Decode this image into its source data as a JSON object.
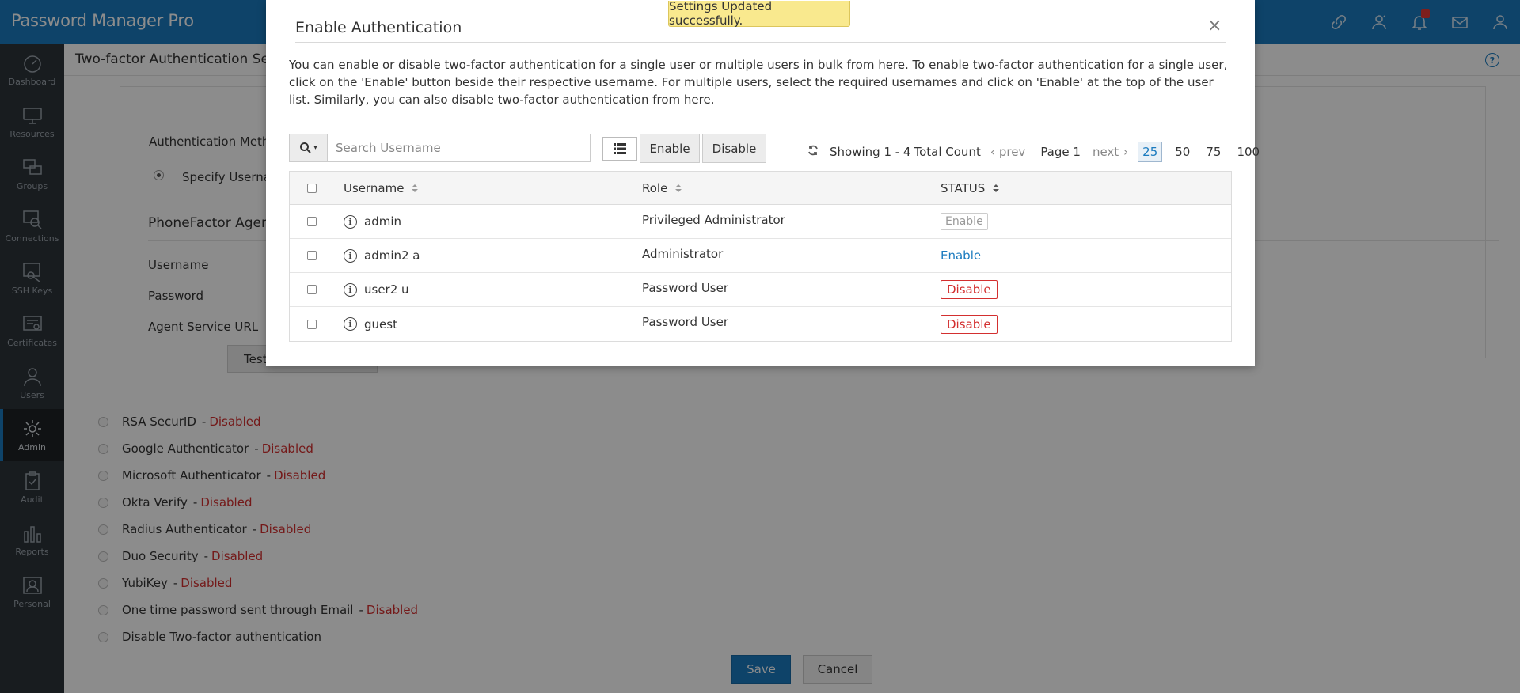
{
  "app": {
    "title": "Password Manager Pro"
  },
  "topbar": {
    "icons": [
      "link-icon",
      "user-badge-icon",
      "bell-icon",
      "mail-icon",
      "user-icon"
    ]
  },
  "sidebar": {
    "items": [
      {
        "label": "Dashboard",
        "icon": "dashboard-icon"
      },
      {
        "label": "Resources",
        "icon": "monitor-icon"
      },
      {
        "label": "Groups",
        "icon": "groups-icon"
      },
      {
        "label": "Connections",
        "icon": "connections-icon"
      },
      {
        "label": "SSH Keys",
        "icon": "ssh-key-icon"
      },
      {
        "label": "Certificates",
        "icon": "certificate-icon"
      },
      {
        "label": "Users",
        "icon": "users-icon"
      },
      {
        "label": "Admin",
        "icon": "gear-icon",
        "active": true
      },
      {
        "label": "Audit",
        "icon": "clipboard-icon"
      },
      {
        "label": "Reports",
        "icon": "bar-chart-icon"
      },
      {
        "label": "Personal",
        "icon": "personal-icon"
      }
    ]
  },
  "page": {
    "title": "Two-factor Authentication Sett",
    "phone_factor": {
      "auth_method_label": "Authentication Metho",
      "specify_user_label": "Specify Usernar",
      "agent_heading": "PhoneFactor Agent",
      "username_label": "Username",
      "password_label": "Password",
      "agent_url_label": "Agent Service URL",
      "test_button": "Test"
    },
    "auth_options": [
      {
        "name": "RSA SecurID",
        "status": "Disabled"
      },
      {
        "name": "Google Authenticator",
        "status": "Disabled"
      },
      {
        "name": "Microsoft Authenticator",
        "status": "Disabled"
      },
      {
        "name": "Okta Verify",
        "status": "Disabled"
      },
      {
        "name": "Radius Authenticator",
        "status": "Disabled"
      },
      {
        "name": "Duo Security",
        "status": "Disabled"
      },
      {
        "name": "YubiKey",
        "status": "Disabled"
      },
      {
        "name": "One time password sent through Email",
        "status": "Disabled"
      },
      {
        "name": "Disable Two-factor authentication",
        "status": ""
      }
    ],
    "save_label": "Save",
    "cancel_label": "Cancel"
  },
  "toast": {
    "message": "Settings Updated successfully."
  },
  "modal": {
    "title": "Enable Authentication",
    "close": "×",
    "description": "You can enable or disable two-factor authentication for a single user or multiple users in bulk from here. To enable two-factor authentication for a single user, click on the 'Enable' button beside their respective username. For multiple users, select the required usernames and click on 'Enable' at the top of the user list. Similarly, you can also disable two-factor authentication from here.",
    "search": {
      "placeholder": "Search Username",
      "value": ""
    },
    "enable_label": "Enable",
    "disable_label": "Disable",
    "pager": {
      "showing": "Showing 1 - 4",
      "total_label": "Total Count",
      "prev": "prev",
      "page": "Page 1",
      "next": "next",
      "sizes": [
        "25",
        "50",
        "75",
        "100"
      ],
      "active_size": "25"
    },
    "columns": {
      "username": "Username",
      "role": "Role",
      "status": "STATUS"
    },
    "rows": [
      {
        "username": "admin",
        "role": "Privileged Administrator",
        "status": "Enable",
        "status_type": "disabled-enable"
      },
      {
        "username": "admin2 a",
        "role": "Administrator",
        "status": "Enable",
        "status_type": "enable-link"
      },
      {
        "username": "user2 u",
        "role": "Password User",
        "status": "Disable",
        "status_type": "disable"
      },
      {
        "username": "guest",
        "role": "Password User",
        "status": "Disable",
        "status_type": "disable"
      }
    ]
  },
  "colors": {
    "brand": "#1b7bbf",
    "sidebar": "#2d3339",
    "danger": "#d32f2f",
    "toast": "#f9e98e"
  }
}
